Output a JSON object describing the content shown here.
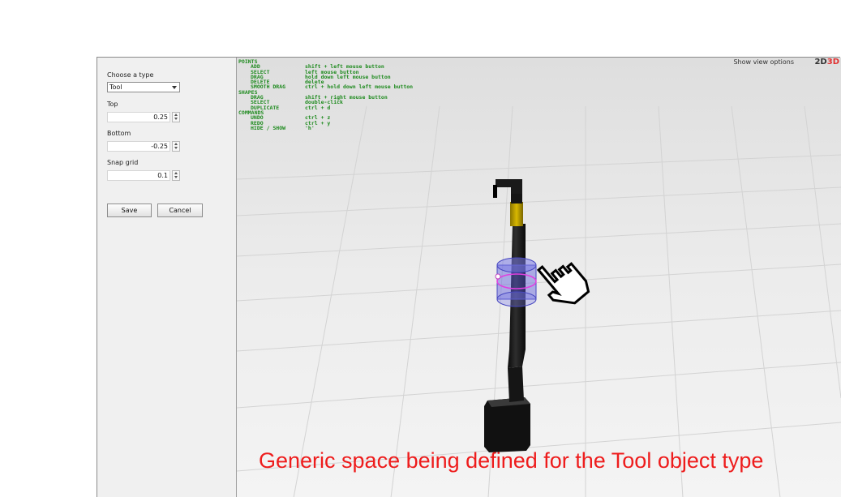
{
  "sidebar": {
    "type_label": "Choose a type",
    "type_value": "Tool",
    "top_label": "Top",
    "top_value": "0.25",
    "bottom_label": "Bottom",
    "bottom_value": "-0.25",
    "snap_label": "Snap grid",
    "snap_value": "0.1",
    "save_label": "Save",
    "cancel_label": "Cancel"
  },
  "help": {
    "points_header": "POINTS",
    "add_key": "ADD",
    "add_val": "shift + left mouse button",
    "select_key": "SELECT",
    "select_val": "left mouse button",
    "drag_key": "DRAG",
    "drag_val": "hold down left mouse button",
    "delete_key": "DELETE",
    "delete_val": "delete",
    "smooth_key": "SMOOTH DRAG",
    "smooth_val": "ctrl + hold down left mouse button",
    "shapes_header": "SHAPES",
    "sdrag_key": "DRAG",
    "sdrag_val": "shift + right mouse button",
    "sselect_key": "SELECT",
    "sselect_val": "double-click",
    "dup_key": "DUPLICATE",
    "dup_val": "ctrl + d",
    "commands_header": "COMMANDS",
    "undo_key": "UNDO",
    "undo_val": "ctrl + z",
    "redo_key": "REDO",
    "redo_val": "ctrl + y",
    "hide_key": "HIDE / SHOW",
    "hide_val": "'h'"
  },
  "viewport": {
    "view_options_label": "Show view options",
    "mode_2d": "2D",
    "mode_3d": "3D",
    "active_mode": "3D"
  },
  "colors": {
    "help_text": "#1d8a1d",
    "caption": "#ee1c1c",
    "selection_volume": "#5a5adc",
    "tool_collar": "#c9a800"
  },
  "icons": {
    "cursor": "hand-pointer-icon",
    "model": "tool-handle-model"
  },
  "caption": "Generic space being defined for the Tool object type"
}
